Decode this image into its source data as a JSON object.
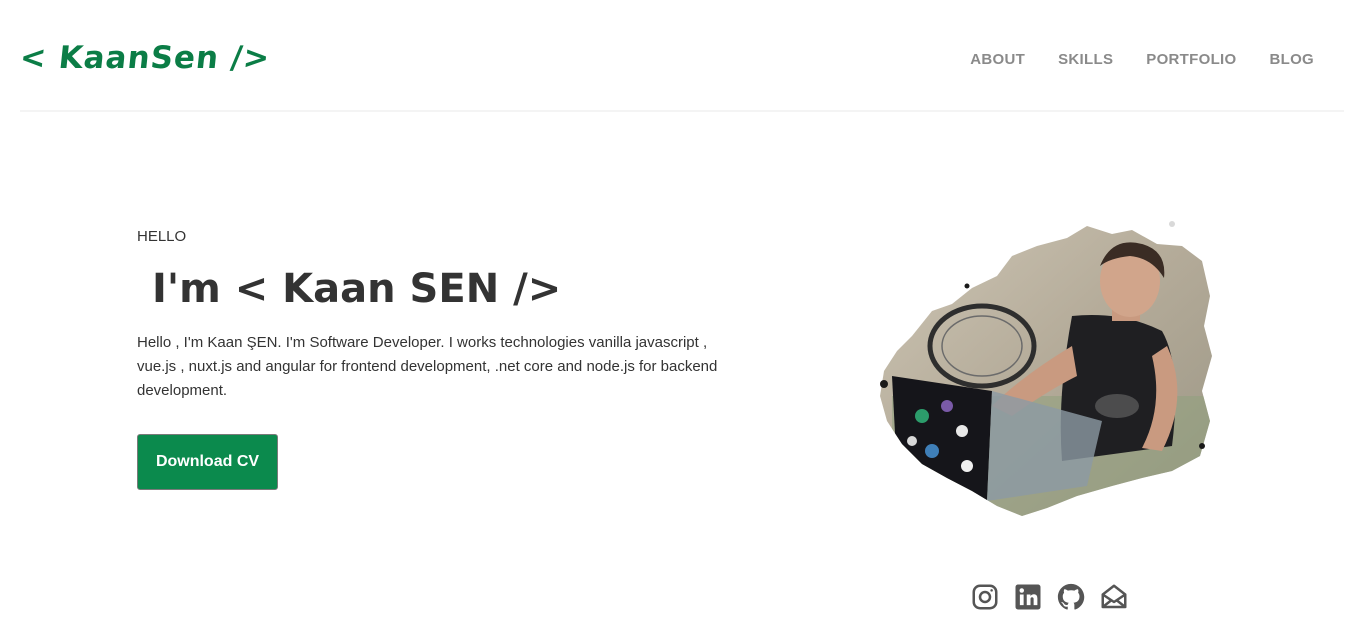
{
  "header": {
    "logo": "< KaanSen />",
    "nav": [
      "ABOUT",
      "SKILLS",
      "PORTFOLIO",
      "BLOG"
    ]
  },
  "hero": {
    "greeting": "HELLO",
    "headline": "I'm < Kaan SEN />",
    "bio": "Hello , I'm Kaan ŞEN. I'm Software Developer. I works technologies vanilla javascript , vue.js , nuxt.js and angular for frontend development, .net core and node.js for backend development.",
    "cta_label": "Download CV"
  },
  "socials": [
    {
      "icon": "instagram-icon"
    },
    {
      "icon": "linkedin-icon"
    },
    {
      "icon": "github-icon"
    },
    {
      "icon": "mail-icon"
    }
  ],
  "colors": {
    "brand": "#0b7d46",
    "button": "#0b8a4d",
    "nav": "#8a8a8a",
    "text": "#333333",
    "icon": "#555555"
  }
}
